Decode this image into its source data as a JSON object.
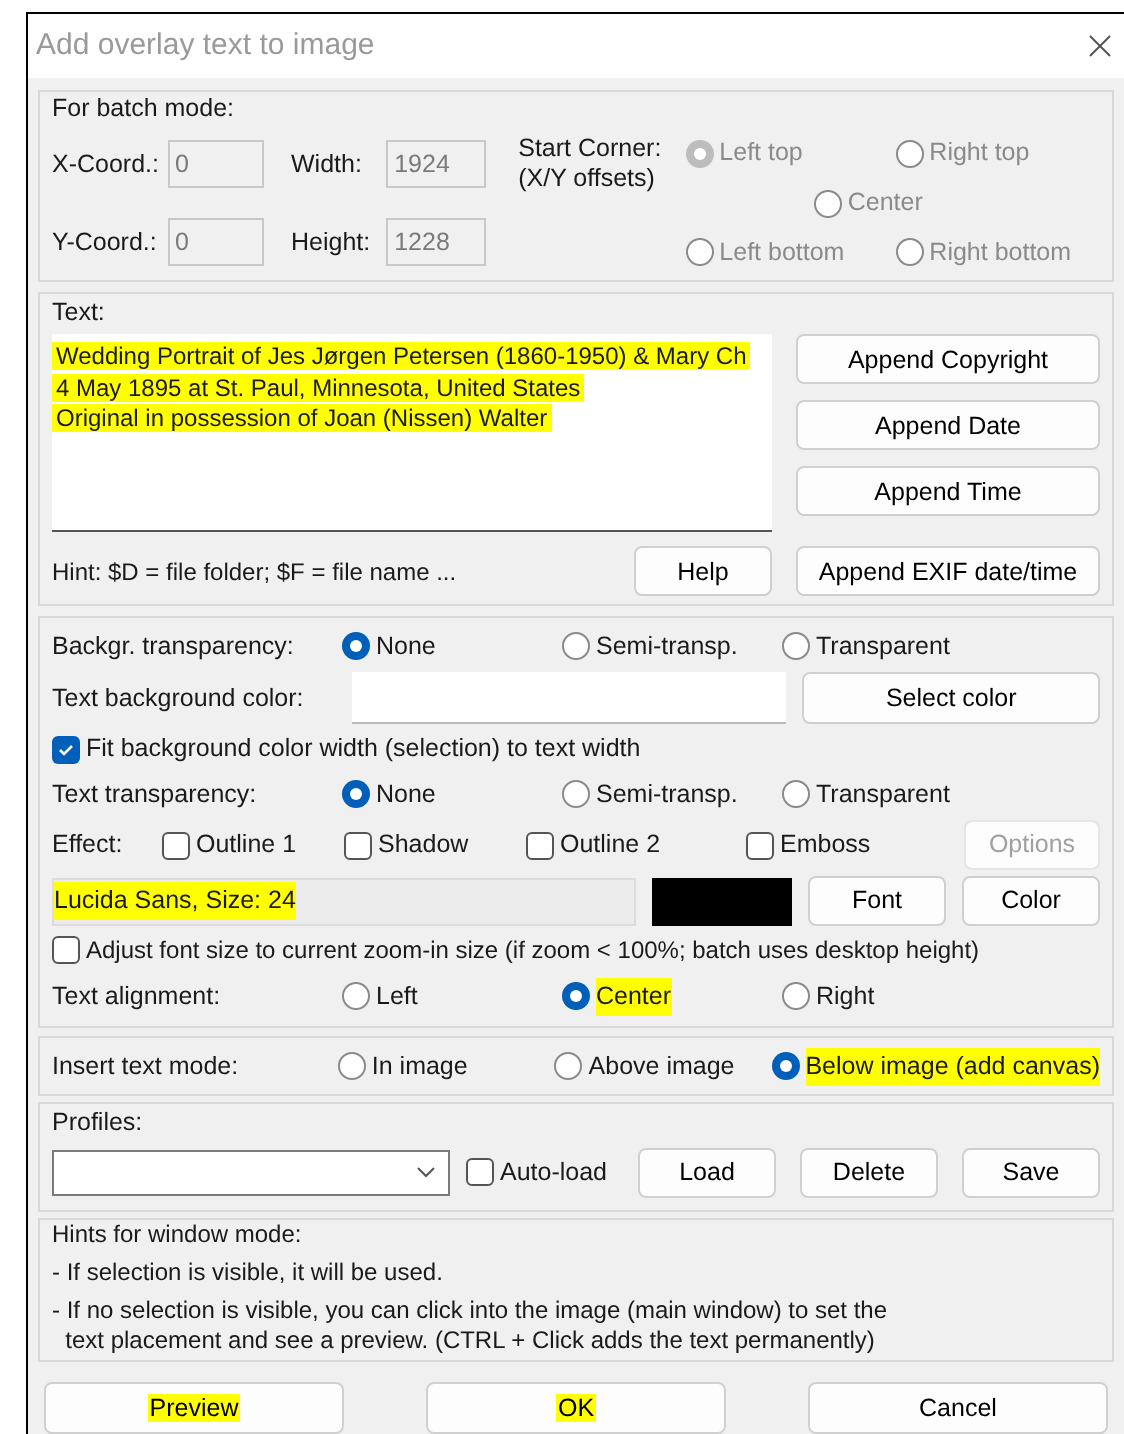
{
  "window": {
    "title": "Add overlay text to image"
  },
  "batch_mode": {
    "title": "For batch mode:",
    "disabled": true,
    "x_label": "X-Coord.:",
    "x_value": "0",
    "y_label": "Y-Coord.:",
    "y_value": "0",
    "width_label": "Width:",
    "width_value": "1924",
    "height_label": "Height:",
    "height_value": "1228",
    "start_corner_label": "Start Corner:",
    "start_corner_note": "(X/Y offsets)",
    "corners": [
      {
        "label": "Left top",
        "selected": true
      },
      {
        "label": "Right top",
        "selected": false
      },
      {
        "label": "Center",
        "selected": false
      },
      {
        "label": "Left bottom",
        "selected": false
      },
      {
        "label": "Right bottom",
        "selected": false
      }
    ]
  },
  "text": {
    "label": "Text:",
    "lines": [
      {
        "text": "Wedding Portrait of Jes Jørgen Petersen (1860-1950) & Mary Ch",
        "highlighted": true
      },
      {
        "text": "4 May 1895 at St. Paul, Minnesota, United States",
        "highlighted": true
      },
      {
        "text": "Original in possession of Joan (Nissen) Walter",
        "highlighted": true
      }
    ],
    "buttons": [
      "Append Copyright",
      "Append Date",
      "Append Time"
    ],
    "hint": "Hint: $D = file folder; $F = file name ...",
    "help_button": "Help",
    "exif_button": "Append EXIF date/time"
  },
  "settings": {
    "bg_transparency": {
      "label": "Backgr. transparency:",
      "options": [
        {
          "label": "None",
          "selected": true
        },
        {
          "label": "Semi-transp.",
          "selected": false
        },
        {
          "label": "Transparent",
          "selected": false
        }
      ]
    },
    "bg_color": {
      "label": "Text background color:",
      "button": "Select color"
    },
    "fit_width": {
      "label": "Fit background color width (selection) to text width",
      "checked": true
    },
    "text_transparency": {
      "label": "Text transparency:",
      "options": [
        {
          "label": "None",
          "selected": true
        },
        {
          "label": "Semi-transp.",
          "selected": false
        },
        {
          "label": "Transparent",
          "selected": false
        }
      ]
    },
    "effect": {
      "label": "Effect:",
      "options": [
        {
          "label": "Outline 1",
          "checked": false
        },
        {
          "label": "Shadow",
          "checked": false
        },
        {
          "label": "Outline 2",
          "checked": false
        },
        {
          "label": "Emboss",
          "checked": false
        }
      ],
      "options_button": {
        "label": "Options",
        "disabled": true
      }
    },
    "font": {
      "display": "Lucida Sans, Size: 24",
      "highlighted": true,
      "color": "#000000",
      "font_button": "Font",
      "color_button": "Color"
    },
    "adjust_font": {
      "label": "Adjust font size to current zoom-in size (if zoom < 100%; batch uses desktop height)",
      "checked": false
    },
    "alignment": {
      "label": "Text alignment:",
      "options": [
        {
          "label": "Left",
          "selected": false,
          "highlighted": false
        },
        {
          "label": "Center",
          "selected": true,
          "highlighted": true
        },
        {
          "label": "Right",
          "selected": false,
          "highlighted": false
        }
      ]
    }
  },
  "insert_mode": {
    "label": "Insert text mode:",
    "options": [
      {
        "label": "In image",
        "selected": false,
        "highlighted": false
      },
      {
        "label": "Above image",
        "selected": false,
        "highlighted": false
      },
      {
        "label": "Below image (add canvas)",
        "selected": true,
        "highlighted": true
      }
    ]
  },
  "profiles": {
    "title": "Profiles:",
    "autoload": {
      "label": "Auto-load",
      "checked": false
    },
    "buttons": [
      "Load",
      "Delete",
      "Save"
    ]
  },
  "hints": {
    "title": "Hints for window mode:",
    "lines": [
      "- If selection is visible, it will be used.",
      "- If no selection is visible, you can click into the image (main window) to set the\n  text placement and see a preview. (CTRL + Click adds the text permanently)"
    ]
  },
  "footer_buttons": [
    {
      "label": "Preview",
      "highlighted": true
    },
    {
      "label": "OK",
      "highlighted": true
    },
    {
      "label": "Cancel",
      "highlighted": false
    }
  ]
}
